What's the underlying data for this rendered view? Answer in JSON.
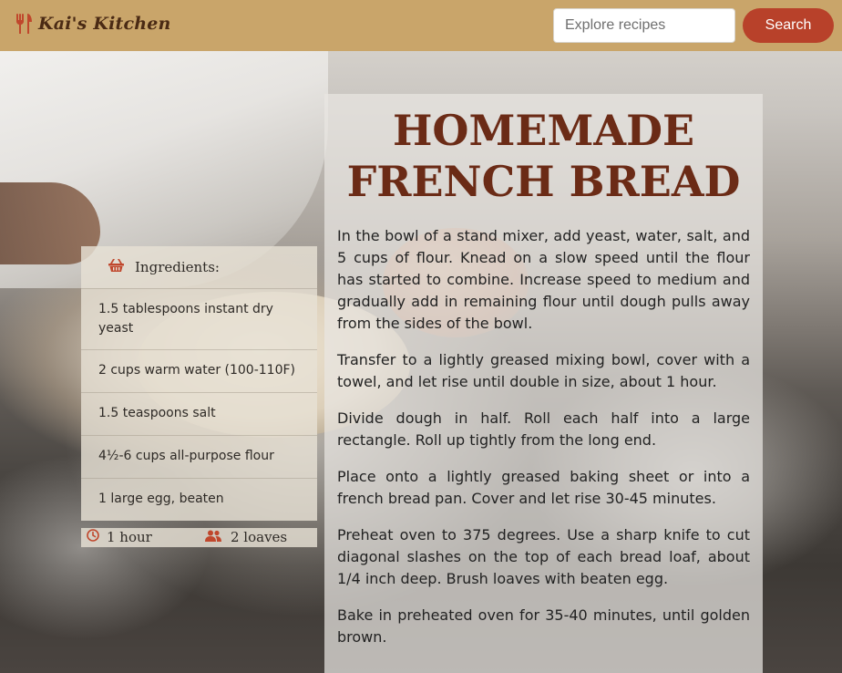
{
  "header": {
    "logo_text": "Kai's Kitchen",
    "logo_icon": "utensils-icon",
    "search_placeholder": "Explore recipes",
    "search_value": "",
    "search_button_label": "Search"
  },
  "colors": {
    "header_bg": "#c9a56a",
    "search_button_bg": "#b8412a",
    "title_color": "#6b2b16",
    "icon_color": "#c0472c"
  },
  "ingredients": {
    "title": "Ingredients:",
    "icon": "basket-icon",
    "items": [
      "1.5 tablespoons instant dry yeast",
      "2 cups warm water (100-110F)",
      "1.5 teaspoons salt",
      "4½-6 cups all-purpose flour",
      "1 large egg, beaten"
    ]
  },
  "meta": {
    "time_icon": "clock-icon",
    "time": "1 hour",
    "yield_icon": "users-icon",
    "yield": "2 loaves"
  },
  "recipe": {
    "title": "Homemade French Bread",
    "steps": [
      "In the bowl of a stand mixer, add yeast, water, salt, and 5 cups of flour. Knead on a slow speed until the flour has started to combine. Increase speed to medium and gradually add in remaining flour until dough pulls away from the sides of the bowl.",
      "Transfer to a lightly greased mixing bowl, cover with a towel, and let rise until double in size, about 1 hour.",
      "Divide dough in half. Roll each half into a large rectangle. Roll up tightly from the long end.",
      "Place onto a lightly greased baking sheet or into a french bread pan. Cover and let rise 30-45 minutes.",
      "Preheat oven to 375 degrees. Use a sharp knife to cut diagonal slashes on the top of each bread loaf, about 1/4 inch deep. Brush loaves with beaten egg.",
      "Bake in preheated oven for 35-40 minutes, until golden brown."
    ]
  }
}
